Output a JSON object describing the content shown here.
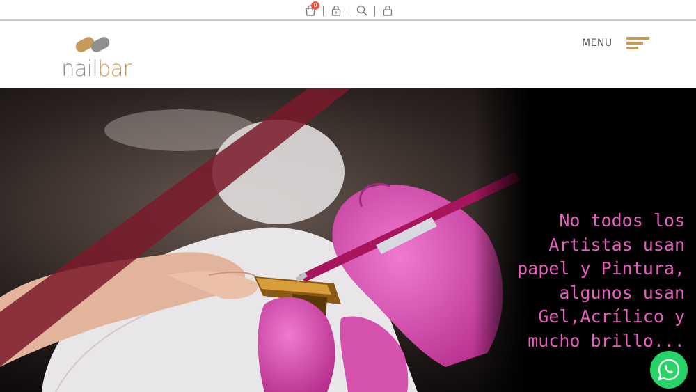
{
  "topbar": {
    "icons": [
      "cart-icon",
      "lock-icon",
      "search-icon",
      "user-lock-icon"
    ],
    "cart_count": "0"
  },
  "header": {
    "logo": {
      "part1": "nail",
      "part2": "bar"
    },
    "menu_label": "MENU"
  },
  "hero": {
    "lines": [
      "No todos los",
      "Artistas usan",
      "papel y Pintura,",
      "algunos usan",
      "Gel,Acrílico y",
      "mucho brillo..."
    ]
  },
  "colors": {
    "brand_gold": "#c79a5a",
    "brand_gray": "#8f8f8f",
    "hero_text": "#e95fc0",
    "whatsapp": "#25d366",
    "badge": "#e8533f"
  }
}
